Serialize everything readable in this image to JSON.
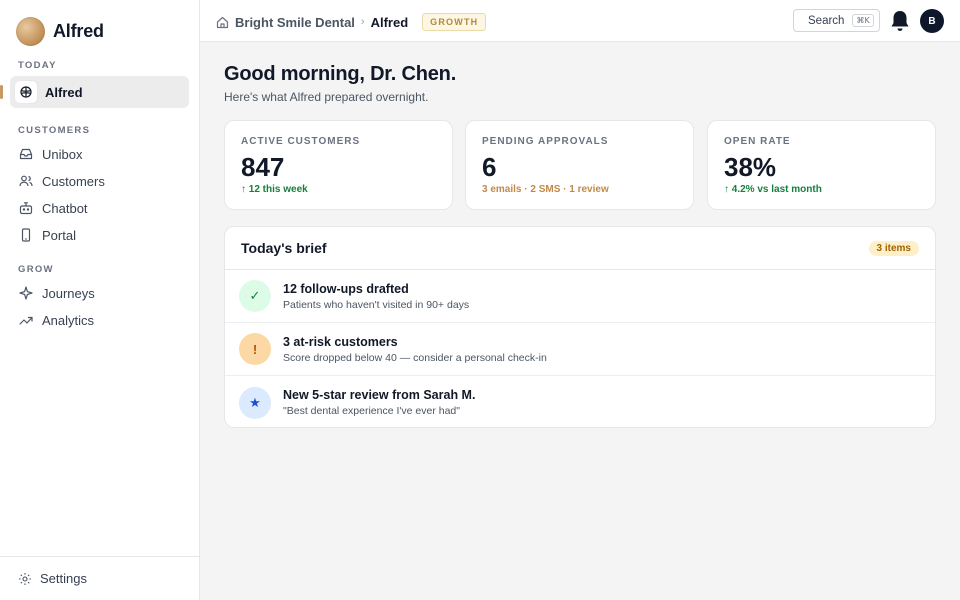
{
  "brand": {
    "name": "Alfred"
  },
  "sidebar": {
    "sections": [
      {
        "label": "TODAY",
        "items": [
          {
            "label": "Alfred",
            "icon": "alfred-logo-icon",
            "active": true
          }
        ]
      },
      {
        "label": "CUSTOMERS",
        "items": [
          {
            "label": "Unibox",
            "icon": "inbox-icon"
          },
          {
            "label": "Customers",
            "icon": "users-icon"
          },
          {
            "label": "Chatbot",
            "icon": "bot-icon"
          },
          {
            "label": "Portal",
            "icon": "device-icon"
          }
        ]
      },
      {
        "label": "GROW",
        "items": [
          {
            "label": "Journeys",
            "icon": "sparkle-icon"
          },
          {
            "label": "Analytics",
            "icon": "trend-icon"
          }
        ]
      }
    ],
    "footer": {
      "label": "Settings",
      "icon": "gear-icon"
    }
  },
  "topbar": {
    "breadcrumb": {
      "workspace": "Bright Smile Dental",
      "separator": "›",
      "current": "Alfred"
    },
    "plan_badge": "GROWTH",
    "search_label": "Search",
    "search_shortcut": "⌘K",
    "avatar_initial": "B"
  },
  "main": {
    "greeting": "Good morning, Dr. Chen.",
    "subgreeting": "Here's what Alfred prepared overnight.",
    "stats": [
      {
        "label": "ACTIVE CUSTOMERS",
        "value": "847",
        "sub": "↑ 12 this week",
        "tone": "green"
      },
      {
        "label": "PENDING APPROVALS",
        "value": "6",
        "sub": "3 emails · 2 SMS · 1 review",
        "tone": "amber"
      },
      {
        "label": "OPEN RATE",
        "value": "38%",
        "sub": "↑ 4.2% vs last month",
        "tone": "green"
      }
    ],
    "brief": {
      "title": "Today's brief",
      "count": "3 items",
      "items": [
        {
          "icon_glyph": "✓",
          "icon": "check-icon",
          "tone": "green",
          "title": "12 follow-ups drafted",
          "sub": "Patients who haven't visited in 90+ days"
        },
        {
          "icon_glyph": "!",
          "icon": "alert-icon",
          "tone": "amber",
          "title": "3 at-risk customers",
          "sub": "Score dropped below 40 — consider a personal check-in"
        },
        {
          "icon_glyph": "★",
          "icon": "star-icon",
          "tone": "blue",
          "title": "New 5-star review from Sarah M.",
          "sub": "\"Best dental experience I've ever had\""
        }
      ]
    }
  },
  "colors": {
    "accent": "#c89a62",
    "positive": "#15803d",
    "warning": "#c2894a",
    "sidebar_active": "#ececec",
    "avatar_bg": "#0f172a"
  }
}
